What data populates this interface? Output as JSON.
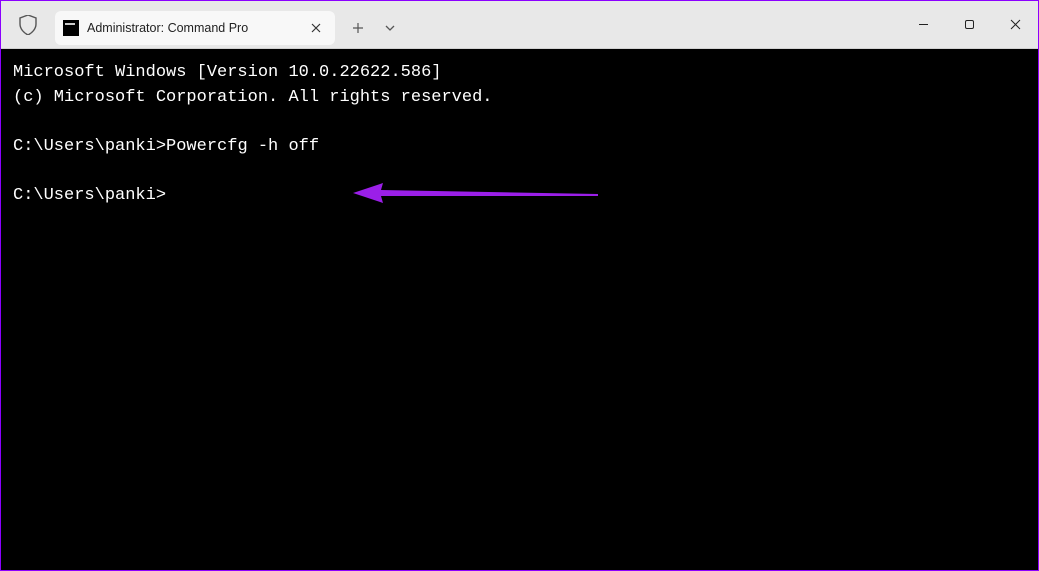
{
  "window": {
    "tab_title": "Administrator: Command Pro"
  },
  "terminal": {
    "line1": "Microsoft Windows [Version 10.0.22622.586]",
    "line2": "(c) Microsoft Corporation. All rights reserved.",
    "prompt1": "C:\\Users\\panki>",
    "command1": "Powercfg -h off",
    "prompt2": "C:\\Users\\panki>"
  },
  "annotation": {
    "color": "#9b1fe8"
  }
}
